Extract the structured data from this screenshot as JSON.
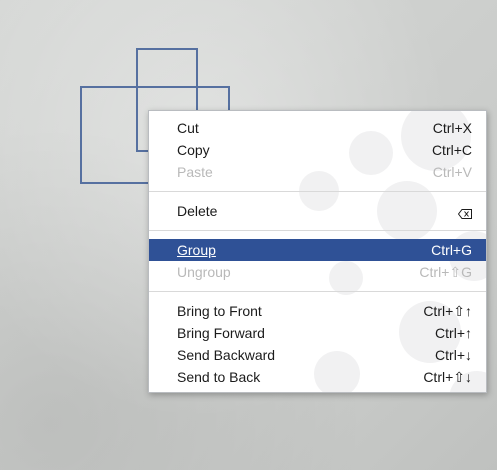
{
  "context_menu": {
    "items": [
      {
        "label": "Cut",
        "shortcut": "Ctrl+X",
        "state": "enabled"
      },
      {
        "label": "Copy",
        "shortcut": "Ctrl+C",
        "state": "enabled"
      },
      {
        "label": "Paste",
        "shortcut": "Ctrl+V",
        "state": "disabled"
      },
      {
        "label": "Delete",
        "shortcut_icon": "backspace-delete-icon",
        "state": "enabled"
      },
      {
        "label": "Group",
        "shortcut": "Ctrl+G",
        "state": "highlighted"
      },
      {
        "label": "Ungroup",
        "shortcut": "Ctrl+⇧G",
        "state": "disabled"
      },
      {
        "label": "Bring to Front",
        "shortcut": "Ctrl+⇧↑",
        "state": "enabled"
      },
      {
        "label": "Bring Forward",
        "shortcut": "Ctrl+↑",
        "state": "enabled"
      },
      {
        "label": "Send Backward",
        "shortcut": "Ctrl+↓",
        "state": "enabled"
      },
      {
        "label": "Send to Back",
        "shortcut": "Ctrl+⇧↓",
        "state": "enabled"
      }
    ]
  },
  "colors": {
    "highlight": "#2f5196",
    "shape_stroke": "#5670a0",
    "disabled_text": "#b9b9b9"
  }
}
